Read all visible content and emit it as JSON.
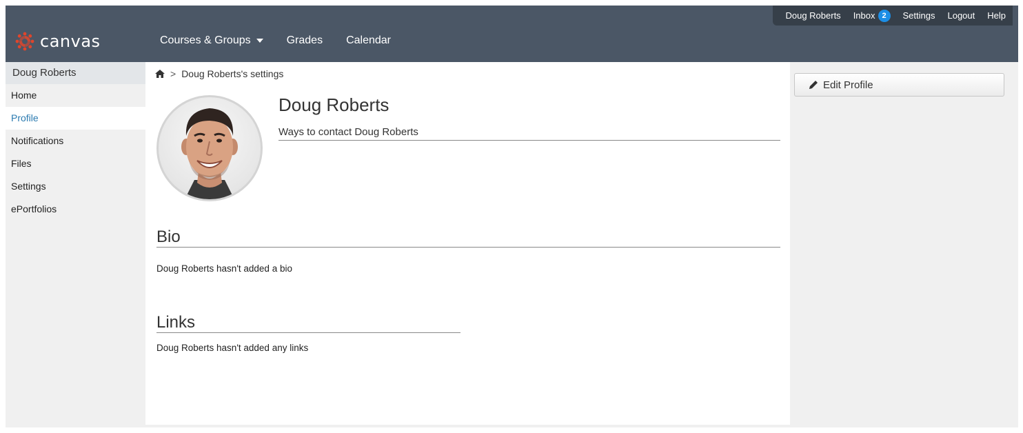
{
  "topbar": {
    "user_name": "Doug Roberts",
    "inbox_label": "Inbox",
    "inbox_count": "2",
    "settings_label": "Settings",
    "logout_label": "Logout",
    "help_label": "Help"
  },
  "brand": {
    "logo_text": "canvas",
    "accent": "#e0452b"
  },
  "mainnav": {
    "courses_label": "Courses & Groups",
    "grades_label": "Grades",
    "calendar_label": "Calendar"
  },
  "leftnav": {
    "header": "Doug Roberts",
    "items": [
      {
        "label": "Home"
      },
      {
        "label": "Profile",
        "active": true
      },
      {
        "label": "Notifications"
      },
      {
        "label": "Files"
      },
      {
        "label": "Settings"
      },
      {
        "label": "ePortfolios"
      }
    ]
  },
  "breadcrumb": {
    "home_icon": "home-icon",
    "separator": ">",
    "current": "Doug Roberts's settings"
  },
  "profile": {
    "name": "Doug Roberts",
    "contact_heading": "Ways to contact Doug Roberts",
    "bio_title": "Bio",
    "bio_text": "Doug Roberts hasn't added a bio",
    "links_title": "Links",
    "links_text": "Doug Roberts hasn't added any links"
  },
  "sidebar_right": {
    "edit_profile_label": "Edit Profile"
  },
  "colors": {
    "header_bg": "#4b5766",
    "topbar_bg": "#363f49",
    "link_blue": "#2a7ab0",
    "badge_blue": "#1c8ee6"
  }
}
